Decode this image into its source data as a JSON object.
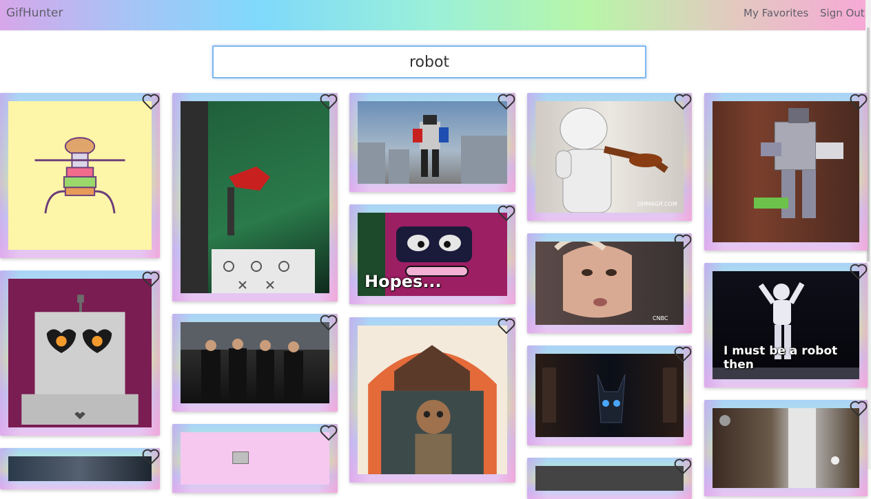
{
  "app": {
    "brand": "GifHunter"
  },
  "nav": {
    "favorites": "My Favorites",
    "signout": "Sign Out"
  },
  "search": {
    "value": "robot"
  },
  "gifs": {
    "g7": {
      "caption": "Hopes..."
    },
    "g9": {
      "watermark": "OHMAGIF.COM"
    },
    "g10": {
      "watermark": "CNBC"
    },
    "g14": {
      "caption": "I must be a robot then"
    }
  }
}
